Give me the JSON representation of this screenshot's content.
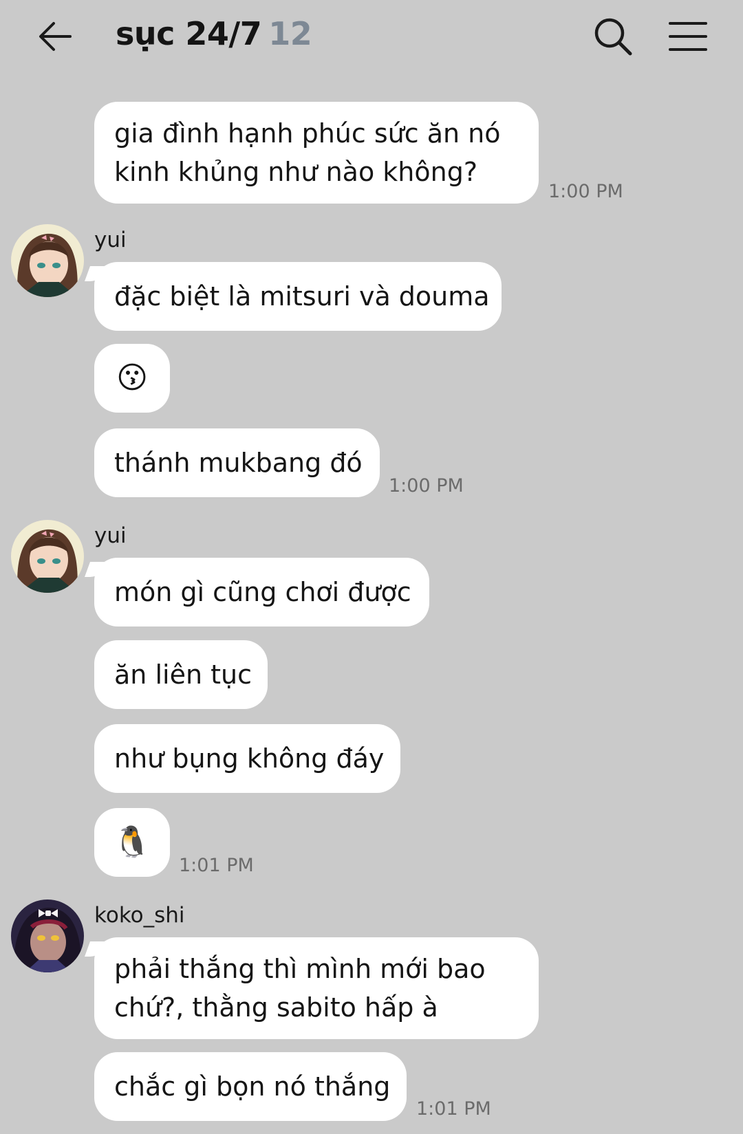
{
  "header": {
    "title": "sục 24/7",
    "member_count": "12",
    "back_icon": "arrow-left-icon",
    "search_icon": "search-icon",
    "menu_icon": "hamburger-menu-icon"
  },
  "messages": {
    "m1": {
      "line1": "gia đình hạnh phúc sức ăn nó",
      "line2": "kinh khủng như nào không?",
      "time": "1:00 PM"
    },
    "g1": {
      "sender": "yui"
    },
    "m2": {
      "text": "đặc biệt là mitsuri và douma"
    },
    "m3": {
      "emoji": "😗"
    },
    "m4": {
      "text": "thánh mukbang đó",
      "time": "1:00 PM"
    },
    "g2": {
      "sender": "yui"
    },
    "m5": {
      "text": "món gì cũng chơi được"
    },
    "m6": {
      "text": "ăn liên tục"
    },
    "m7": {
      "text": "như bụng không đáy"
    },
    "m8": {
      "emoji": "🐧",
      "time": "1:01 PM"
    },
    "g3": {
      "sender": "koko_shi"
    },
    "m9": {
      "line1": "phải thắng thì mình mới bao",
      "line2": "chứ?, thằng sabito hấp à"
    },
    "m10": {
      "text": "chắc gì bọn nó thắng",
      "time": "1:01 PM"
    }
  },
  "colors": {
    "background": "#cacaca",
    "bubble": "#ffffff",
    "member_count": "#7d8894"
  }
}
